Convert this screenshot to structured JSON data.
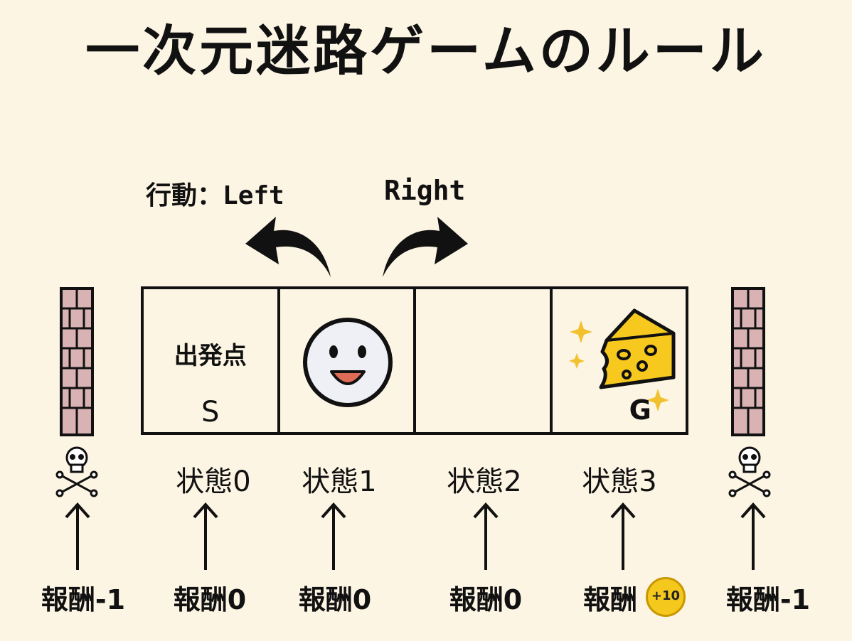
{
  "title": "一次元迷路ゲームのルール",
  "actions": {
    "prefix": "行動：",
    "left": "Left",
    "right": "Right"
  },
  "cells": {
    "start_label": "出発点",
    "start_letter": "S",
    "goal_letter": "G"
  },
  "states": [
    "状態0",
    "状態1",
    "状態2",
    "状態3"
  ],
  "rewards": {
    "left_wall": "報酬-1",
    "state0": "報酬0",
    "state1": "報酬0",
    "state2": "報酬0",
    "state3": "報酬",
    "state3_coin": "+10",
    "right_wall": "報酬-1"
  },
  "colors": {
    "background": "#fdf5e4",
    "brick": "#d9b3b3",
    "cheese": "#f7c91e",
    "coin": "#f4c81c"
  },
  "icons": {
    "wall": "brick-wall-icon",
    "skull": "skull-crossbones-icon",
    "agent": "smiley-face-icon",
    "goal": "cheese-icon"
  }
}
